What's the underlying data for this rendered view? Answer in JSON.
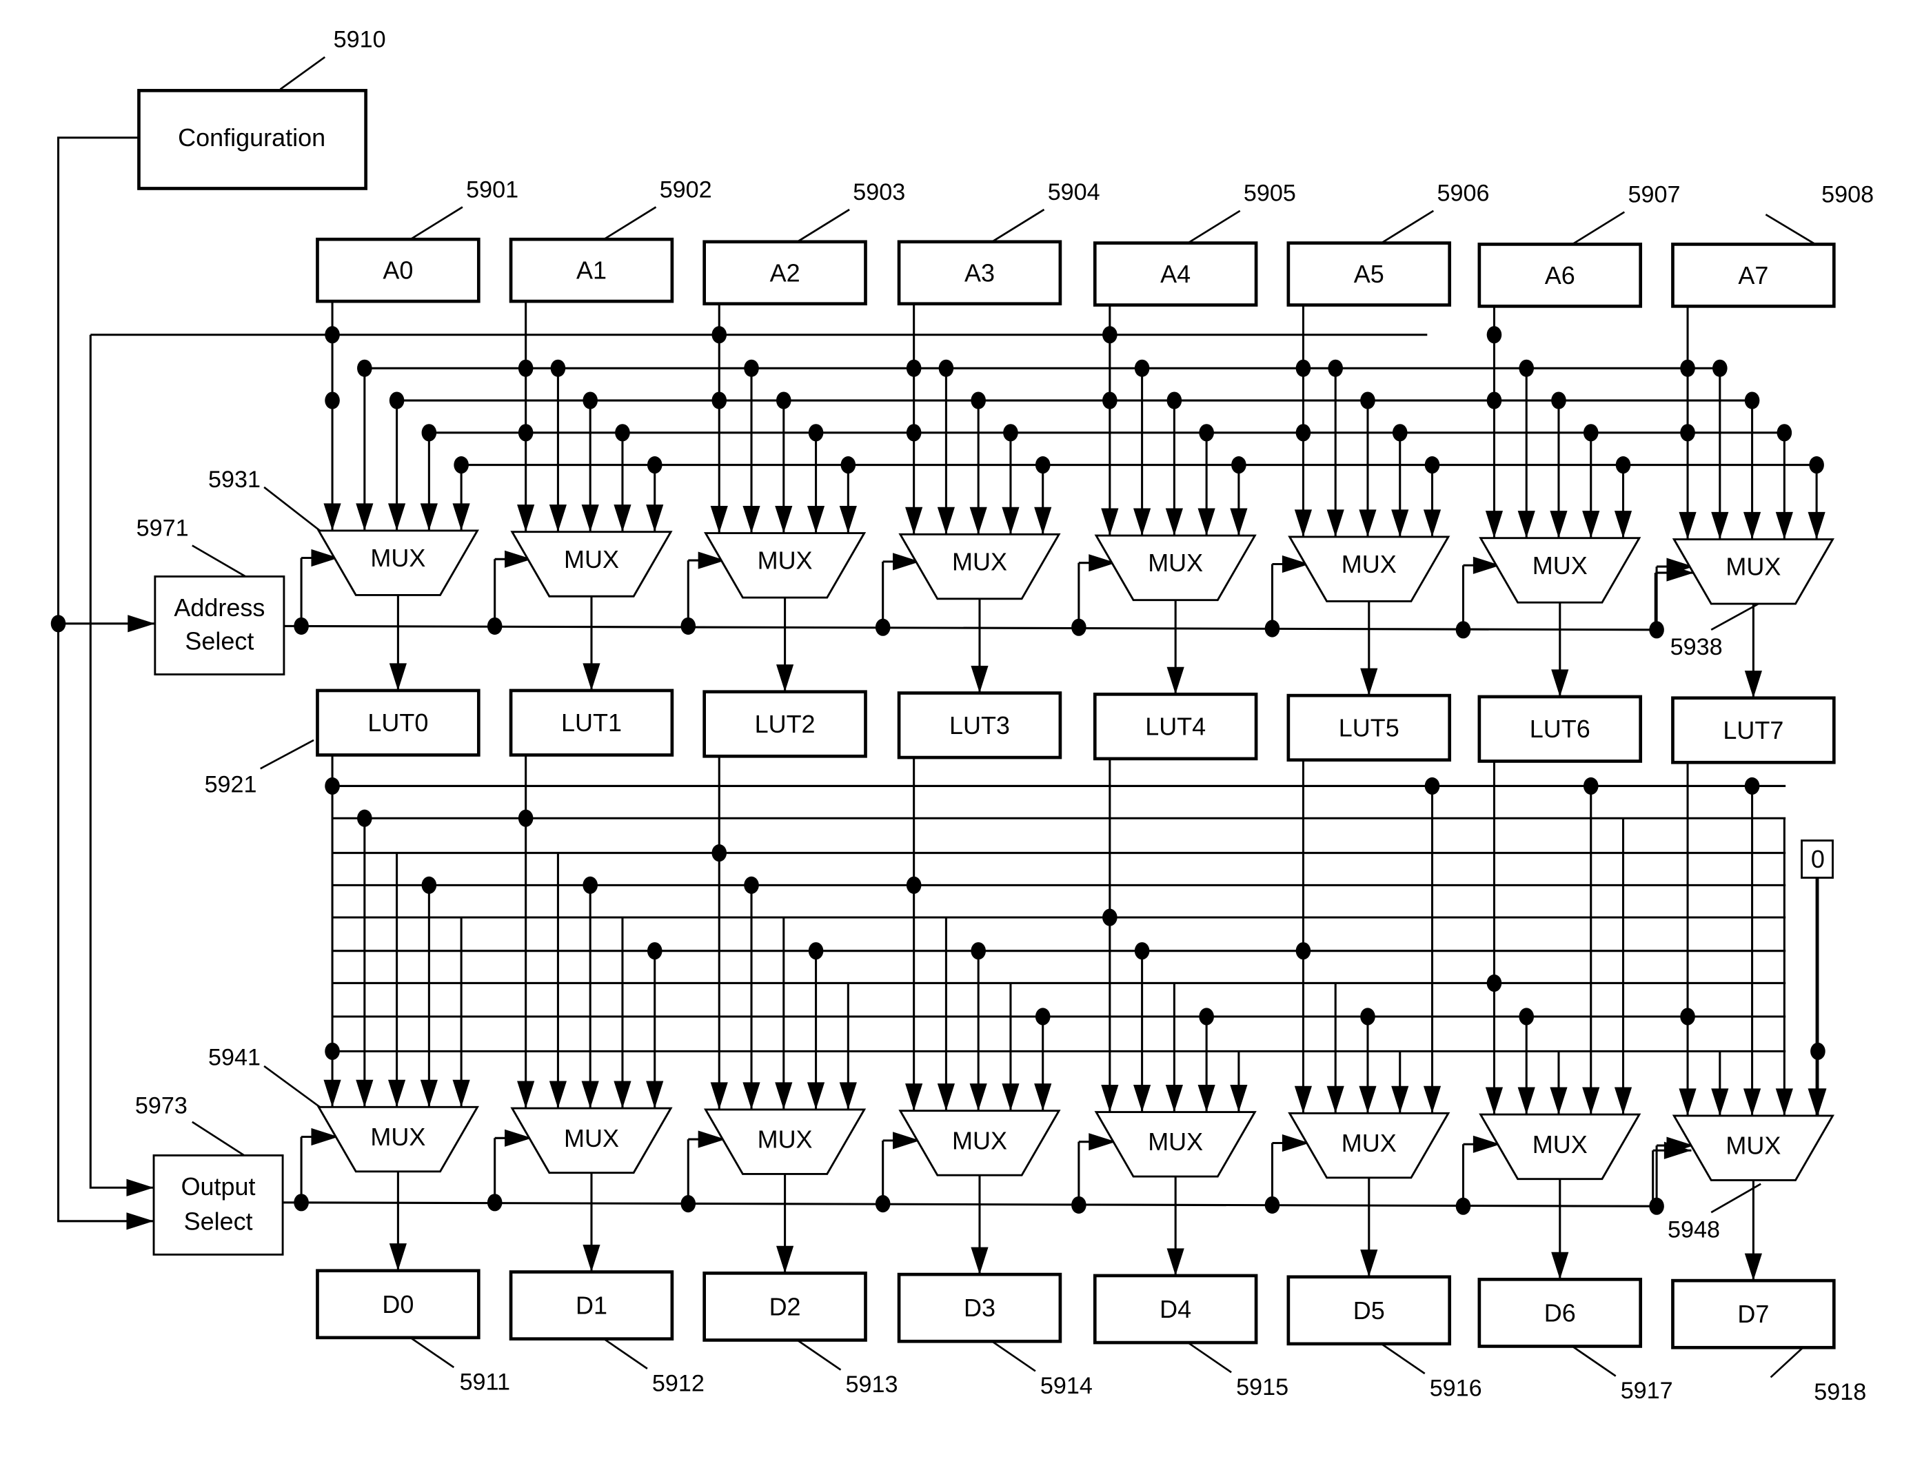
{
  "config": {
    "label": "Configuration",
    "ref": "5910"
  },
  "address_select": {
    "line1": "Address",
    "line2": "Select",
    "ref": "5971"
  },
  "output_select": {
    "line1": "Output",
    "line2": "Select",
    "ref": "5973"
  },
  "inputs": [
    {
      "label": "A0",
      "ref": "5901"
    },
    {
      "label": "A1",
      "ref": "5902"
    },
    {
      "label": "A2",
      "ref": "5903"
    },
    {
      "label": "A3",
      "ref": "5904"
    },
    {
      "label": "A4",
      "ref": "5905"
    },
    {
      "label": "A5",
      "ref": "5906"
    },
    {
      "label": "A6",
      "ref": "5907"
    },
    {
      "label": "A7",
      "ref": "5908"
    }
  ],
  "luts": [
    "LUT0",
    "LUT1",
    "LUT2",
    "LUT3",
    "LUT4",
    "LUT5",
    "LUT6",
    "LUT7"
  ],
  "outputs": [
    {
      "label": "D0",
      "ref": "5911"
    },
    {
      "label": "D1",
      "ref": "5912"
    },
    {
      "label": "D2",
      "ref": "5913"
    },
    {
      "label": "D3",
      "ref": "5914"
    },
    {
      "label": "D4",
      "ref": "5915"
    },
    {
      "label": "D5",
      "ref": "5916"
    },
    {
      "label": "D6",
      "ref": "5917"
    },
    {
      "label": "D7",
      "ref": "5918"
    }
  ],
  "mux_label": "MUX",
  "refs": {
    "mux_top_first": "5931",
    "mux_top_last": "5938",
    "mux_bottom_first": "5941",
    "mux_bottom_last": "5948",
    "lut_first": "5921"
  },
  "constant": {
    "label": "0"
  }
}
